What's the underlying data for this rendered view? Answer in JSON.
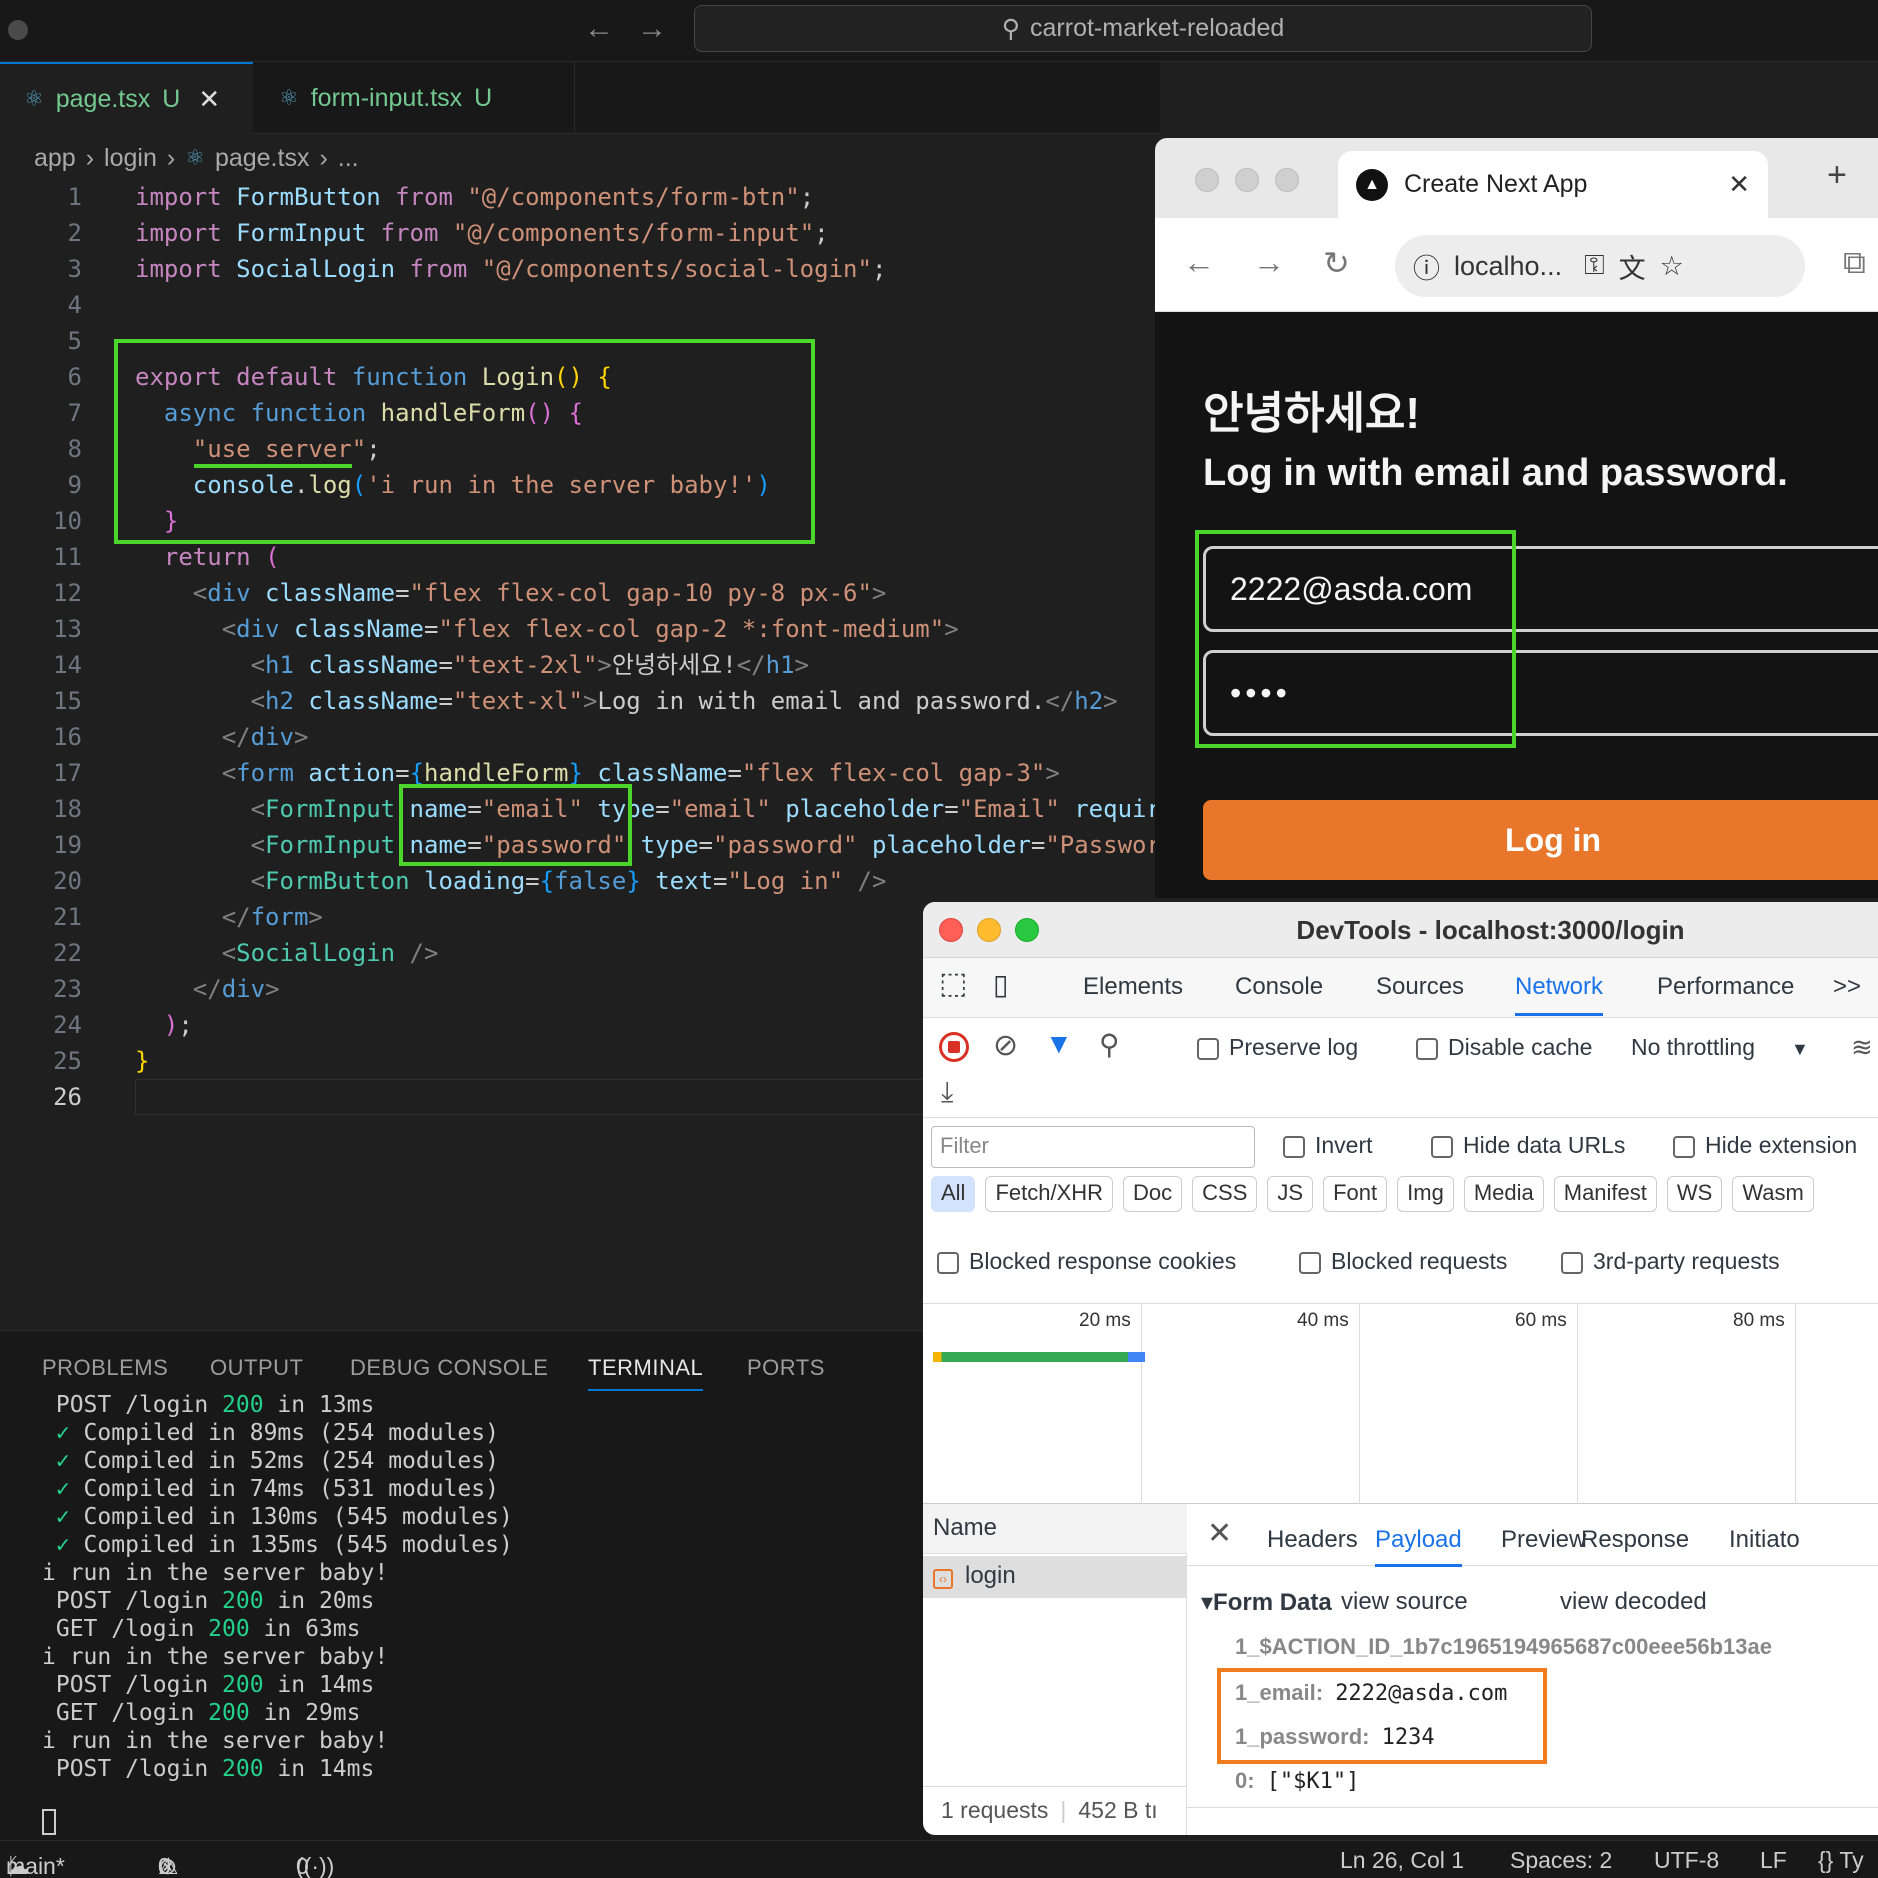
{
  "titlebar": {
    "search_text": "carrot-market-reloaded"
  },
  "editor_tabs": [
    {
      "label": "page.tsx",
      "status": "U"
    },
    {
      "label": "form-input.tsx",
      "status": "U"
    }
  ],
  "breadcrumb": {
    "parts": [
      "app",
      "login",
      "page.tsx",
      "..."
    ]
  },
  "code": {
    "line_numbers": [
      "1",
      "2",
      "3",
      "4",
      "5",
      "6",
      "7",
      "8",
      "9",
      "10",
      "11",
      "12",
      "13",
      "14",
      "15",
      "16",
      "17",
      "18",
      "19",
      "20",
      "21",
      "22",
      "23",
      "24",
      "25",
      "26"
    ],
    "lines": [
      {
        "t": [
          [
            "k",
            "import "
          ],
          [
            "v",
            "FormButton "
          ],
          [
            "k",
            "from "
          ],
          [
            "s",
            "\"@/components/form-btn\""
          ],
          [
            "",
            "; "
          ]
        ]
      },
      {
        "t": [
          [
            "k",
            "import "
          ],
          [
            "v",
            "FormInput "
          ],
          [
            "k",
            "from "
          ],
          [
            "s",
            "\"@/components/form-input\""
          ],
          [
            "",
            ";"
          ]
        ]
      },
      {
        "t": [
          [
            "k",
            "import "
          ],
          [
            "v",
            "SocialLogin "
          ],
          [
            "k",
            "from "
          ],
          [
            "s",
            "\"@/components/social-login\""
          ],
          [
            "",
            ";"
          ]
        ]
      },
      {
        "t": []
      },
      {
        "t": []
      },
      {
        "t": [
          [
            "k",
            "export default "
          ],
          [
            "b",
            "function "
          ],
          [
            "f",
            "Login"
          ],
          [
            "y",
            "() {"
          ]
        ]
      },
      {
        "t": [
          [
            "",
            "  "
          ],
          [
            "b",
            "async function "
          ],
          [
            "f",
            "handleForm"
          ],
          [
            "pk",
            "() {"
          ]
        ]
      },
      {
        "t": [
          [
            "",
            "    "
          ],
          [
            "s",
            "\"use server\""
          ],
          [
            "",
            ";"
          ]
        ]
      },
      {
        "t": [
          [
            "",
            "    "
          ],
          [
            "v",
            "console"
          ],
          [
            "",
            "."
          ],
          [
            "f",
            "log"
          ],
          [
            "g",
            "("
          ],
          [
            "s",
            "'i run in the server baby!'"
          ],
          [
            "g",
            ")"
          ]
        ]
      },
      {
        "t": [
          [
            "",
            "  "
          ],
          [
            "pk",
            "}"
          ]
        ]
      },
      {
        "t": [
          [
            "",
            "  "
          ],
          [
            "k",
            "return "
          ],
          [
            "pk",
            "("
          ]
        ]
      },
      {
        "t": [
          [
            "",
            "    "
          ],
          [
            "p",
            "<"
          ],
          [
            "tag",
            "div "
          ],
          [
            "v",
            "className"
          ],
          [
            "",
            "="
          ],
          [
            "s",
            "\"flex flex-col gap-10 py-8 px-6\""
          ],
          [
            "p",
            ">"
          ]
        ]
      },
      {
        "t": [
          [
            "",
            "      "
          ],
          [
            "p",
            "<"
          ],
          [
            "tag",
            "div "
          ],
          [
            "v",
            "className"
          ],
          [
            "",
            "="
          ],
          [
            "s",
            "\"flex flex-col gap-2 *:font-medium\""
          ],
          [
            "p",
            ">"
          ]
        ]
      },
      {
        "t": [
          [
            "",
            "        "
          ],
          [
            "p",
            "<"
          ],
          [
            "tag",
            "h1 "
          ],
          [
            "v",
            "className"
          ],
          [
            "",
            "="
          ],
          [
            "s",
            "\"text-2xl\""
          ],
          [
            "p",
            ">"
          ],
          [
            "",
            "안녕하세요!"
          ],
          [
            "p",
            "</"
          ],
          [
            "tag",
            "h1"
          ],
          [
            "p",
            ">"
          ]
        ]
      },
      {
        "t": [
          [
            "",
            "        "
          ],
          [
            "p",
            "<"
          ],
          [
            "tag",
            "h2 "
          ],
          [
            "v",
            "className"
          ],
          [
            "",
            "="
          ],
          [
            "s",
            "\"text-xl\""
          ],
          [
            "p",
            ">"
          ],
          [
            "",
            "Log in with email and password."
          ],
          [
            "p",
            "</"
          ],
          [
            "tag",
            "h2"
          ],
          [
            "p",
            ">"
          ]
        ]
      },
      {
        "t": [
          [
            "",
            "      "
          ],
          [
            "p",
            "</"
          ],
          [
            "tag",
            "div"
          ],
          [
            "p",
            ">"
          ]
        ]
      },
      {
        "t": [
          [
            "",
            "      "
          ],
          [
            "p",
            "<"
          ],
          [
            "tag",
            "form "
          ],
          [
            "v",
            "action"
          ],
          [
            "",
            "="
          ],
          [
            "g",
            "{"
          ],
          [
            "f",
            "handleForm"
          ],
          [
            "g",
            "}"
          ],
          [
            "v",
            " className"
          ],
          [
            "",
            "="
          ],
          [
            "s",
            "\"flex flex-col gap-3\""
          ],
          [
            "p",
            ">"
          ]
        ]
      },
      {
        "t": [
          [
            "",
            "        "
          ],
          [
            "p",
            "<"
          ],
          [
            "t",
            "FormInput "
          ],
          [
            "v",
            "name"
          ],
          [
            "",
            "="
          ],
          [
            "s",
            "\"email\" "
          ],
          [
            "v",
            "type"
          ],
          [
            "",
            "="
          ],
          [
            "s",
            "\"email\" "
          ],
          [
            "v",
            "placeholder"
          ],
          [
            "",
            "="
          ],
          [
            "s",
            "\"Email\" "
          ],
          [
            "v",
            "requir"
          ]
        ]
      },
      {
        "t": [
          [
            "",
            "        "
          ],
          [
            "p",
            "<"
          ],
          [
            "t",
            "FormInput "
          ],
          [
            "v",
            "name"
          ],
          [
            "",
            "="
          ],
          [
            "s",
            "\"password\" "
          ],
          [
            "v",
            "type"
          ],
          [
            "",
            "="
          ],
          [
            "s",
            "\"password\" "
          ],
          [
            "v",
            "placeholder"
          ],
          [
            "",
            "="
          ],
          [
            "s",
            "\"Passwor"
          ]
        ]
      },
      {
        "t": [
          [
            "",
            "        "
          ],
          [
            "p",
            "<"
          ],
          [
            "t",
            "FormButton "
          ],
          [
            "v",
            "loading"
          ],
          [
            "",
            "="
          ],
          [
            "g",
            "{"
          ],
          [
            "b",
            "false"
          ],
          [
            "g",
            "} "
          ],
          [
            "v",
            "text"
          ],
          [
            "",
            "="
          ],
          [
            "s",
            "\"Log in\" "
          ],
          [
            "p",
            "/>"
          ]
        ]
      },
      {
        "t": [
          [
            "",
            "      "
          ],
          [
            "p",
            "</"
          ],
          [
            "tag",
            "form"
          ],
          [
            "p",
            ">"
          ]
        ]
      },
      {
        "t": [
          [
            "",
            "      "
          ],
          [
            "p",
            "<"
          ],
          [
            "t",
            "SocialLogin "
          ],
          [
            "p",
            "/>"
          ]
        ]
      },
      {
        "t": [
          [
            "",
            "    "
          ],
          [
            "p",
            "</"
          ],
          [
            "tag",
            "div"
          ],
          [
            "p",
            ">"
          ]
        ]
      },
      {
        "t": [
          [
            "",
            "  "
          ],
          [
            "pk",
            ")"
          ],
          [
            "",
            ";"
          ]
        ]
      },
      {
        "t": [
          [
            "y",
            "}"
          ]
        ]
      },
      {
        "t": []
      }
    ]
  },
  "panel": {
    "tabs": [
      "PROBLEMS",
      "OUTPUT",
      "DEBUG CONSOLE",
      "TERMINAL",
      "PORTS"
    ],
    "active_tab": "TERMINAL",
    "terminal_lines": [
      [
        " POST /login ",
        "200",
        " in 13ms"
      ],
      [
        " ✓ Compiled in 89ms (254 modules)"
      ],
      [
        " ✓ Compiled in 52ms (254 modules)"
      ],
      [
        " ✓ Compiled in 74ms (531 modules)"
      ],
      [
        " ✓ Compiled in 130ms (545 modules)"
      ],
      [
        " ✓ Compiled in 135ms (545 modules)"
      ],
      [
        "i run in the server baby!"
      ],
      [
        " POST /login ",
        "200",
        " in 20ms"
      ],
      [
        " GET /login ",
        "200",
        " in 63ms"
      ],
      [
        "i run in the server baby!"
      ],
      [
        " POST /login ",
        "200",
        " in 14ms"
      ],
      [
        " GET /login ",
        "200",
        " in 29ms"
      ],
      [
        "i run in the server baby!"
      ],
      [
        " POST /login ",
        "200",
        " in 14ms"
      ]
    ]
  },
  "statusbar": {
    "branch": "main*",
    "errors": "0",
    "warnings": "0",
    "ports": "0",
    "position": "Ln 26, Col 1",
    "spaces": "Spaces: 2",
    "encoding": "UTF-8",
    "eol": "LF",
    "language": "{} Ty"
  },
  "browser": {
    "tab_title": "Create Next App",
    "url": "localho...",
    "heading": "안녕하세요!",
    "subheading": "Log in with email and password.",
    "email_value": "2222@asda.com",
    "password_value": "••••",
    "login_button": "Log in",
    "accent_color": "#e8762b"
  },
  "devtools": {
    "title": "DevTools - localhost:3000/login",
    "tabs": [
      "Elements",
      "Console",
      "Sources",
      "Network",
      "Performance",
      ">>"
    ],
    "active_tab": "Network",
    "preserve_log": "Preserve log",
    "disable_cache": "Disable cache",
    "throttling": "No throttling",
    "filter_placeholder": "Filter",
    "invert": "Invert",
    "hide_data_urls": "Hide data URLs",
    "hide_extension": "Hide extension",
    "type_chips": [
      "All",
      "Fetch/XHR",
      "Doc",
      "CSS",
      "JS",
      "Font",
      "Img",
      "Media",
      "Manifest",
      "WS",
      "Wasm"
    ],
    "blocked_cookies": "Blocked response cookies",
    "blocked_requests": "Blocked requests",
    "third_party": "3rd-party requests",
    "timeline_ticks": [
      "20 ms",
      "40 ms",
      "60 ms",
      "80 ms"
    ],
    "name_header": "Name",
    "request_name": "login",
    "detail_tabs": [
      "Headers",
      "Payload",
      "Preview",
      "Response",
      "Initiato"
    ],
    "active_detail_tab": "Payload",
    "form_data_label": "▾Form Data",
    "view_source": "view source",
    "view_decoded": "view decoded",
    "action_id": "1_$ACTION_ID_1b7c1965194965687c00eee56b13ae",
    "fields": [
      {
        "key": "1_email:",
        "value": "2222@asda.com"
      },
      {
        "key": "1_password:",
        "value": "1234"
      },
      {
        "key": "0:",
        "value": "[\"$K1\"]"
      }
    ],
    "requests_count": "1 requests",
    "transfer": "452 B tı"
  }
}
